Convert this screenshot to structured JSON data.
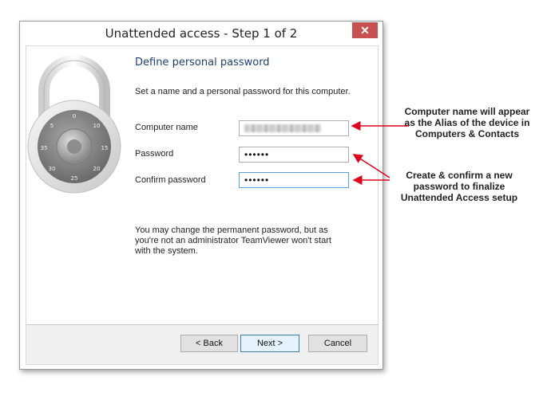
{
  "window": {
    "title": "Unattended access - Step 1 of 2",
    "close_label": "✕"
  },
  "form": {
    "heading": "Define personal password",
    "intro": "Set a name and a personal password for this computer.",
    "computer_name_label": "Computer name",
    "password_label": "Password",
    "password_value": "••••••",
    "confirm_label": "Confirm password",
    "confirm_value": "••••••",
    "note": "You may change the permanent password, but as you're not an administrator TeamViewer won't start with the system."
  },
  "buttons": {
    "back": "< Back",
    "next": "Next >",
    "cancel": "Cancel"
  },
  "annotations": {
    "computer_name_callout": "Computer name will appear as the Alias of the device in Computers & Contacts",
    "password_callout": "Create & confirm a new password to finalize Unattended Access setup",
    "arrow_color": "#e0001a"
  },
  "icons": {
    "padlock": "padlock-icon"
  }
}
